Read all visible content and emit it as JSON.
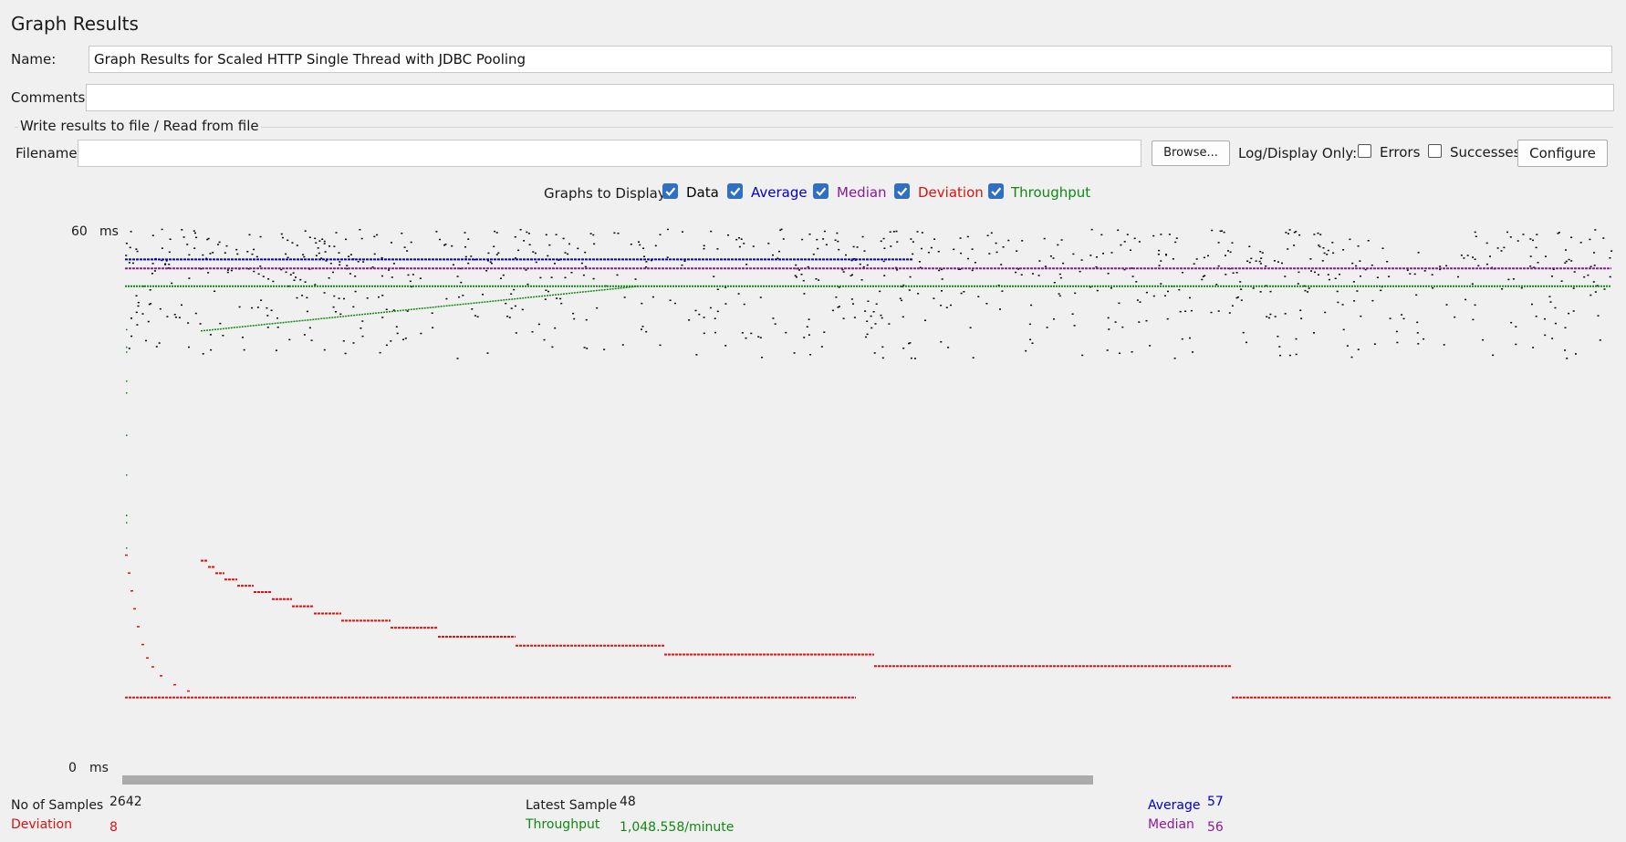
{
  "window": {
    "title": "Graph Results"
  },
  "form": {
    "name_label": "Name:",
    "name_value": "Graph Results for Scaled HTTP Single Thread with JDBC Pooling",
    "comments_label": "Comments:",
    "comments_value": "",
    "file_section_title": "Write results to file / Read from file",
    "filename_label": "Filename",
    "filename_value": "",
    "browse_label": "Browse...",
    "log_display_label": "Log/Display Only:",
    "errors_label": "Errors",
    "errors_checked": false,
    "successes_label": "Successes",
    "successes_checked": false,
    "configure_label": "Configure"
  },
  "graphs": {
    "label": "Graphs to Display",
    "items": [
      {
        "label": "Data",
        "checked": true,
        "color": "#000000"
      },
      {
        "label": "Average",
        "checked": true,
        "color": "#0000cc"
      },
      {
        "label": "Median",
        "checked": true,
        "color": "#8b1a9a"
      },
      {
        "label": "Deviation",
        "checked": true,
        "color": "#dd1111"
      },
      {
        "label": "Throughput",
        "checked": true,
        "color": "#118811"
      }
    ]
  },
  "chart_data": {
    "type": "scatter",
    "title": "",
    "ylabel_unit": "ms",
    "y_max_label": "60",
    "y_min_label": "0",
    "ylim": [
      0,
      60
    ],
    "samples": 2642,
    "series": [
      {
        "name": "Average",
        "color": "#0000cc",
        "values_start_end": [
          57,
          57
        ]
      },
      {
        "name": "Median",
        "color": "#8b1a9a",
        "values_start_end": [
          56,
          56
        ]
      },
      {
        "name": "Deviation",
        "color": "#dd1111",
        "values_start_end": [
          24,
          8
        ]
      },
      {
        "name": "Throughput",
        "color": "#118811",
        "values_start_end": [
          52,
          54
        ]
      }
    ]
  },
  "stats": {
    "samples_label": "No of Samples",
    "samples_value": "2642",
    "deviation_label": "Deviation",
    "deviation_value": "8",
    "latest_label": "Latest Sample",
    "latest_value": "48",
    "throughput_label": "Throughput",
    "throughput_value": "1,048.558/minute",
    "average_label": "Average",
    "average_value": "57",
    "median_label": "Median",
    "median_value": "56"
  },
  "colors": {
    "average": "#0000cc",
    "median": "#8b1a9a",
    "deviation": "#dd1111",
    "throughput": "#118811",
    "data": "#000000"
  }
}
